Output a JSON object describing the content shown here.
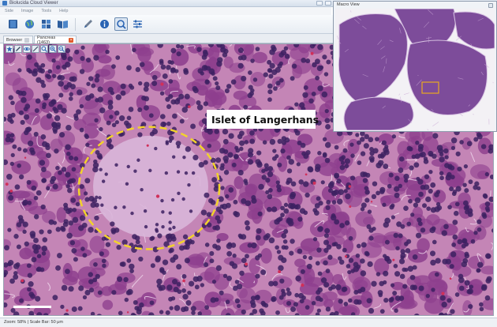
{
  "window": {
    "title": "Biolucida Cloud Viewer"
  },
  "menu": {
    "items": [
      "Side",
      "Image",
      "Tools",
      "Help"
    ]
  },
  "toolbar": {
    "buttons": [
      "book-icon",
      "globe-icon",
      "tiles-icon",
      "open-book-icon",
      "pen-icon",
      "info-icon",
      "measure-icon",
      "sliders-icon"
    ]
  },
  "tabs": [
    {
      "label": "Browser"
    },
    {
      "label": "Pancreas (1463)"
    }
  ],
  "viewer": {
    "annotation_label": "Islet of Langerhans",
    "annotation_color": "#f2d22c",
    "tools": [
      "star-icon",
      "pencil-icon",
      "eye-icon",
      "brush-icon",
      "search-icon",
      "zoom-in-icon",
      "zoom-out-icon"
    ]
  },
  "statusbar": {
    "text": "Zoom: 58% | Scale Bar: 50 μm"
  },
  "macro": {
    "title": "Macro View",
    "roi_color": "#e8a820"
  },
  "colors": {
    "background": "#c485b6",
    "nucleus": "#3d2161",
    "cytoplasm": "#8e3f8e",
    "islet": "#d9b6d9"
  }
}
